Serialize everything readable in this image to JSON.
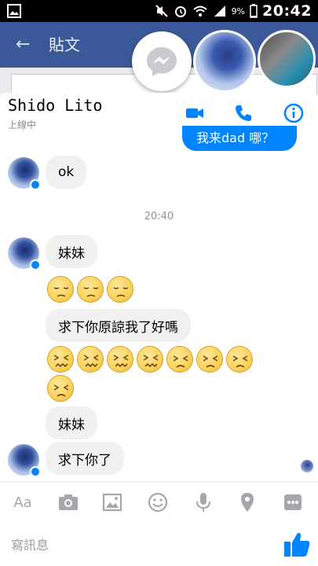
{
  "status_bar": {
    "battery_text": "9%",
    "time": "20:42"
  },
  "background_app": {
    "title": "貼文"
  },
  "chat_heads": [
    {
      "name": "messenger-head-icon"
    },
    {
      "name": "contact-head-1"
    },
    {
      "name": "contact-head-2"
    }
  ],
  "conversation": {
    "contact_name": "Shido Lito",
    "presence": "上線中",
    "my_partial_bubble": "我来dad 哪？"
  },
  "messages": [
    {
      "text": "ok"
    },
    {
      "timestamp": "20:40"
    },
    {
      "text": "妹妹"
    },
    {
      "emoji": [
        "pensive",
        "pensive",
        "pensive"
      ]
    },
    {
      "text": "求下你原諒我了好嗎"
    },
    {
      "emoji": [
        "confounded",
        "confounded",
        "confounded",
        "confounded",
        "persevere",
        "persevere",
        "persevere",
        "persevere"
      ]
    },
    {
      "text": "妹妹"
    },
    {
      "text": "求下你了"
    }
  ],
  "composer": {
    "aa_label": "Aa",
    "placeholder": "寫訊息"
  },
  "colors": {
    "accent": "#0084ff",
    "bubble_other": "#f1f0f0",
    "fb_header": "#3b5998"
  }
}
